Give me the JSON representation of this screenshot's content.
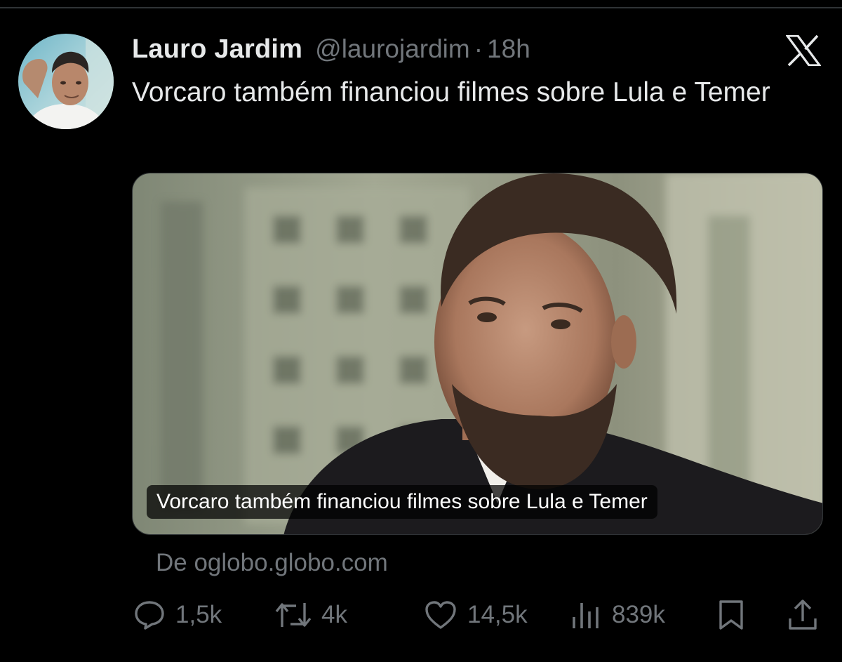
{
  "tweet": {
    "author_name": "Lauro Jardim",
    "author_handle": "@laurojardim",
    "separator": "·",
    "time_ago": "18h",
    "text": "Vorcaro também financiou filmes sobre Lula e Temer",
    "card": {
      "caption": "Vorcaro também financiou filmes sobre Lula e Temer"
    },
    "source": "De oglobo.globo.com"
  },
  "actions": {
    "replies": "1,5k",
    "reposts": "4k",
    "likes": "14,5k",
    "views": "839k"
  },
  "icons": {
    "brand": "x-logo-icon",
    "reply": "reply-icon",
    "repost": "repost-icon",
    "like": "heart-icon",
    "views": "views-icon",
    "bookmark": "bookmark-icon",
    "share": "share-icon"
  },
  "colors": {
    "background": "#000000",
    "text_primary": "#e7e9ea",
    "text_secondary": "#71767b"
  }
}
